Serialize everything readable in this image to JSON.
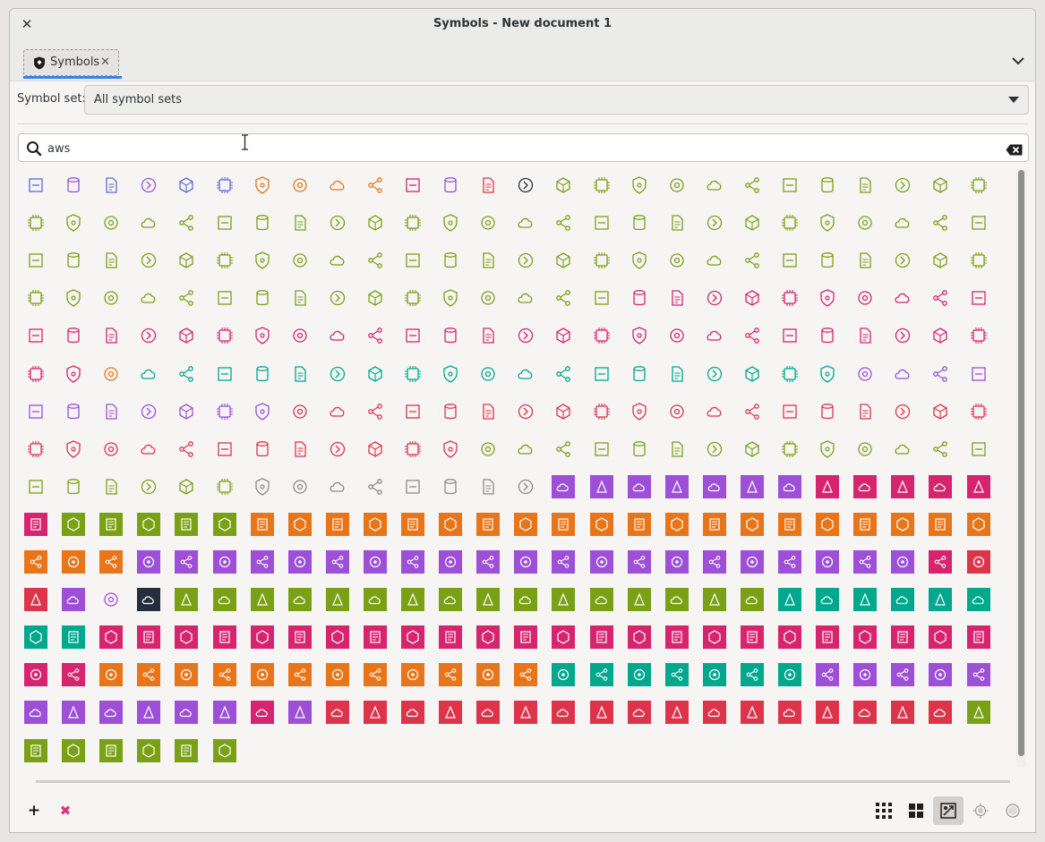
{
  "window": {
    "title": "Symbols - New document 1",
    "close_glyph": "✕"
  },
  "tab": {
    "label": "Symbols",
    "close_glyph": "✕",
    "icon": "symbols-shield-icon"
  },
  "symbol_set": {
    "label": "Symbol set:",
    "value": "All symbol sets"
  },
  "search": {
    "value": "aws",
    "icon": "search-icon",
    "clear_icon": "clear-text-icon"
  },
  "toolbar": {
    "add_glyph": "+",
    "remove_glyph": "✖",
    "view_buttons": [
      {
        "name": "small-grid-view-button",
        "icon": "grid-small-icon"
      },
      {
        "name": "large-grid-view-button",
        "icon": "grid-large-icon"
      },
      {
        "name": "fit-symbols-button",
        "icon": "fit-symbol-icon",
        "active": true
      },
      {
        "name": "zoom-out-button",
        "icon": "zoom-out-icon"
      },
      {
        "name": "zoom-in-button",
        "icon": "zoom-in-icon"
      }
    ]
  },
  "palette": {
    "s": "#5e6ad2",
    "p": "#9d4fd8",
    "o": "#e8751a",
    "g": "#7aa116",
    "m": "#d6246e",
    "r": "#dd344c",
    "t": "#01a88d",
    "d": "#232f3e",
    "gg": "#8a8a8a"
  },
  "symbol_rows": [
    [
      "s:out",
      "p:out",
      "s:out",
      "p:out",
      "s:out",
      "s:out",
      "o:out",
      "o:out",
      "o:out",
      "o:out",
      "m:out",
      "p:out",
      "r:out",
      "d:out",
      "g:out",
      "g:out",
      "g:out",
      "g:out",
      "g:out",
      "g:out",
      "g:out",
      "g:out",
      "g:out",
      "g:out",
      "g:out",
      "g:out"
    ],
    [
      "g:out",
      "g:out",
      "g:out",
      "g:out",
      "g:out",
      "g:out",
      "g:out",
      "g:out",
      "g:out",
      "g:out",
      "g:out",
      "g:out",
      "g:out",
      "g:out",
      "g:out",
      "g:out",
      "g:out",
      "g:out",
      "g:out",
      "g:out",
      "g:out",
      "g:out",
      "g:out",
      "g:out",
      "g:out",
      "g:out"
    ],
    [
      "g:out",
      "g:out",
      "g:out",
      "g:out",
      "g:out",
      "g:out",
      "g:out",
      "g:out",
      "g:out",
      "g:out",
      "g:out",
      "g:out",
      "g:out",
      "g:out",
      "g:out",
      "g:out",
      "g:out",
      "g:out",
      "g:out",
      "g:out",
      "g:out",
      "g:out",
      "g:out",
      "g:out",
      "g:out",
      "g:out"
    ],
    [
      "g:out",
      "g:out",
      "g:out",
      "g:out",
      "g:out",
      "g:out",
      "g:out",
      "g:out",
      "g:out",
      "g:out",
      "g:out",
      "g:out",
      "g:out",
      "g:out",
      "g:out",
      "g:out",
      "m:out",
      "m:out",
      "m:out",
      "m:out",
      "m:out",
      "m:out",
      "m:out",
      "m:out",
      "m:out",
      "m:out"
    ],
    [
      "m:out",
      "m:out",
      "m:out",
      "m:out",
      "m:out",
      "m:out",
      "m:out",
      "m:out",
      "m:out",
      "m:out",
      "m:out",
      "m:out",
      "m:out",
      "m:out",
      "m:out",
      "m:out",
      "m:out",
      "m:out",
      "m:out",
      "m:out",
      "m:out",
      "m:out",
      "m:out",
      "m:out",
      "m:out",
      "m:out"
    ],
    [
      "m:out",
      "m:out",
      "o:out",
      "t:out",
      "t:out",
      "t:out",
      "t:out",
      "t:out",
      "t:out",
      "t:out",
      "t:out",
      "t:out",
      "t:out",
      "t:out",
      "t:out",
      "t:out",
      "t:out",
      "t:out",
      "t:out",
      "t:out",
      "t:out",
      "t:out",
      "p:out",
      "p:out",
      "p:out",
      "p:out"
    ],
    [
      "p:out",
      "p:out",
      "p:out",
      "p:out",
      "p:out",
      "p:out",
      "p:out",
      "r:out",
      "r:out",
      "r:out",
      "r:out",
      "r:out",
      "r:out",
      "r:out",
      "r:out",
      "r:out",
      "r:out",
      "r:out",
      "r:out",
      "r:out",
      "r:out",
      "r:out",
      "r:out",
      "r:out",
      "r:out",
      "r:out"
    ],
    [
      "r:out",
      "r:out",
      "r:out",
      "r:out",
      "r:out",
      "r:out",
      "r:out",
      "r:out",
      "r:out",
      "r:out",
      "r:out",
      "r:out",
      "g:out",
      "g:out",
      "g:out",
      "g:out",
      "g:out",
      "g:out",
      "g:out",
      "g:out",
      "g:out",
      "g:out",
      "g:out",
      "g:out",
      "g:out",
      "g:out"
    ],
    [
      "g:out",
      "g:out",
      "g:out",
      "g:out",
      "g:out",
      "g:out",
      "gg:out",
      "gg:out",
      "gg:out",
      "gg:out",
      "gg:out",
      "gg:out",
      "gg:out",
      "gg:out",
      "p:fill",
      "p:fill",
      "p:fill",
      "p:fill",
      "p:fill",
      "p:fill",
      "p:fill",
      "m:fill",
      "m:fill",
      "m:fill",
      "m:fill",
      "m:fill"
    ],
    [
      "m:fill",
      "g:fill",
      "g:fill",
      "g:fill",
      "g:fill",
      "g:fill",
      "o:fill",
      "o:fill",
      "o:fill",
      "o:fill",
      "o:fill",
      "o:fill",
      "o:fill",
      "o:fill",
      "o:fill",
      "o:fill",
      "o:fill",
      "o:fill",
      "o:fill",
      "o:fill",
      "o:fill",
      "o:fill",
      "o:fill",
      "o:fill",
      "o:fill",
      "o:fill"
    ],
    [
      "o:fill",
      "o:fill",
      "o:fill",
      "p:fill",
      "p:fill",
      "p:fill",
      "p:fill",
      "p:fill",
      "p:fill",
      "p:fill",
      "p:fill",
      "p:fill",
      "p:fill",
      "p:fill",
      "p:fill",
      "p:fill",
      "p:fill",
      "p:fill",
      "p:fill",
      "p:fill",
      "p:fill",
      "p:fill",
      "p:fill",
      "p:fill",
      "m:fill",
      "r:fill"
    ],
    [
      "r:fill",
      "p:fill",
      "p:out",
      "d:fill",
      "g:fill",
      "g:fill",
      "g:fill",
      "g:fill",
      "g:fill",
      "g:fill",
      "g:fill",
      "g:fill",
      "g:fill",
      "g:fill",
      "g:fill",
      "g:fill",
      "g:fill",
      "g:fill",
      "g:fill",
      "g:fill",
      "t:fill",
      "t:fill",
      "t:fill",
      "t:fill",
      "t:fill",
      "t:fill"
    ],
    [
      "t:fill",
      "t:fill",
      "m:fill",
      "m:fill",
      "m:fill",
      "m:fill",
      "m:fill",
      "m:fill",
      "m:fill",
      "m:fill",
      "m:fill",
      "m:fill",
      "m:fill",
      "m:fill",
      "m:fill",
      "m:fill",
      "m:fill",
      "m:fill",
      "m:fill",
      "m:fill",
      "m:fill",
      "m:fill",
      "m:fill",
      "m:fill",
      "m:fill",
      "m:fill"
    ],
    [
      "m:fill",
      "m:fill",
      "o:fill",
      "o:fill",
      "o:fill",
      "o:fill",
      "o:fill",
      "o:fill",
      "o:fill",
      "o:fill",
      "o:fill",
      "o:fill",
      "o:fill",
      "o:fill",
      "t:fill",
      "t:fill",
      "t:fill",
      "t:fill",
      "t:fill",
      "t:fill",
      "t:fill",
      "p:fill",
      "p:fill",
      "p:fill",
      "p:fill",
      "p:fill"
    ],
    [
      "p:fill",
      "p:fill",
      "p:fill",
      "p:fill",
      "p:fill",
      "p:fill",
      "m:fill",
      "p:fill",
      "r:fill",
      "r:fill",
      "r:fill",
      "r:fill",
      "r:fill",
      "r:fill",
      "r:fill",
      "r:fill",
      "r:fill",
      "r:fill",
      "r:fill",
      "r:fill",
      "r:fill",
      "r:fill",
      "r:fill",
      "r:fill",
      "r:fill",
      "g:fill"
    ],
    [
      "g:fill",
      "g:fill",
      "g:fill",
      "g:fill",
      "g:fill",
      "g:fill"
    ]
  ]
}
